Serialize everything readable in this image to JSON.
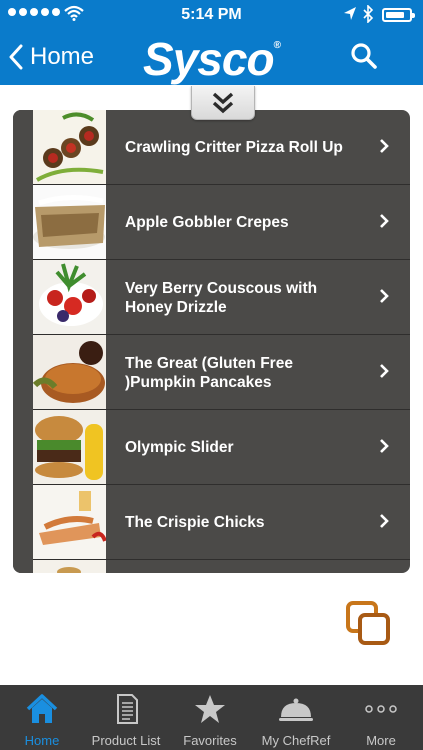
{
  "status_bar": {
    "time": "5:14 PM"
  },
  "nav": {
    "back_label": "Home",
    "logo_text": "Sysco"
  },
  "recipes": [
    {
      "title": "Crawling Critter Pizza Roll Up"
    },
    {
      "title": "Apple Gobbler Crepes"
    },
    {
      "title": "Very Berry Couscous with Honey Drizzle"
    },
    {
      "title": "The Great (Gluten Free )Pumpkin Pancakes"
    },
    {
      "title": "Olympic Slider"
    },
    {
      "title": "The Crispie Chicks"
    }
  ],
  "tabs": [
    {
      "label": "Home",
      "icon": "home-icon",
      "active": true
    },
    {
      "label": "Product List",
      "icon": "document-icon",
      "active": false
    },
    {
      "label": "Favorites",
      "icon": "star-icon",
      "active": false
    },
    {
      "label": "My ChefRef",
      "icon": "cloche-icon",
      "active": false
    },
    {
      "label": "More",
      "icon": "more-icon",
      "active": false
    }
  ],
  "colors": {
    "brand_blue": "#0a7bcb",
    "list_bg": "#4b4a48",
    "tab_bar_bg": "#3a3a3a",
    "tab_active": "#1a8fe0",
    "overlay_icon": "#c8761a"
  }
}
